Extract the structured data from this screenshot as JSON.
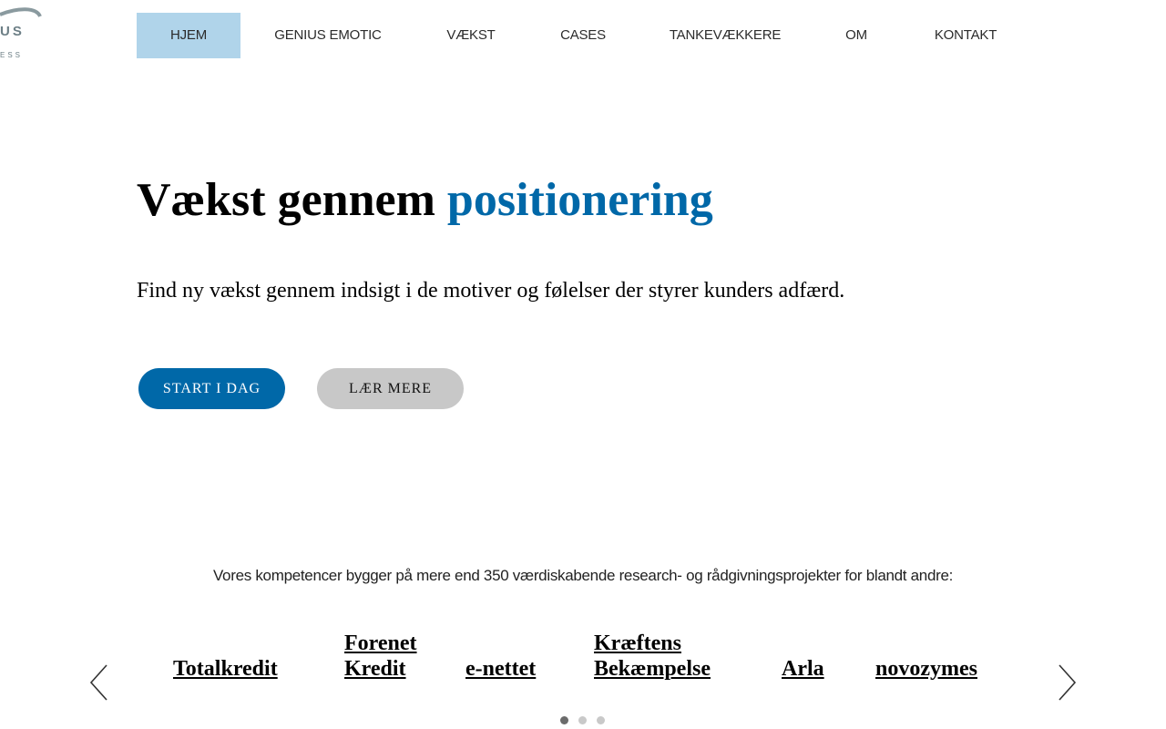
{
  "logo": {
    "word": "US",
    "sub": "ESS"
  },
  "nav": {
    "items": [
      {
        "label": "HJEM",
        "active": true
      },
      {
        "label": "GENIUS EMOTIC",
        "active": false
      },
      {
        "label": "VÆKST",
        "active": false
      },
      {
        "label": "CASES",
        "active": false
      },
      {
        "label": "TANKEVÆKKERE",
        "active": false
      },
      {
        "label": "OM",
        "active": false
      },
      {
        "label": "KONTAKT",
        "active": false
      }
    ]
  },
  "hero": {
    "title_plain": "Vækst gennem",
    "title_accent": "positionering",
    "subtitle": "Find ny vækst gennem indsigt i de motiver og følelser der styrer kunders adfærd.",
    "primary_button": "START I DAG",
    "secondary_button": "LÆR MERE"
  },
  "competence": {
    "text": "Vores kompetencer bygger på mere end 350 værdiskabende research- og rådgivningsprojekter for blandt andre:"
  },
  "clients": [
    {
      "line1": "",
      "line2": "Totalkredit"
    },
    {
      "line1": "Forenet",
      "line2": "Kredit"
    },
    {
      "line1": "",
      "line2": "e-nettet"
    },
    {
      "line1": "Kræftens",
      "line2": "Bekæmpelse"
    },
    {
      "line1": "",
      "line2": "Arla"
    },
    {
      "line1": "",
      "line2": "novozymes"
    }
  ],
  "carousel": {
    "active_dot": 1,
    "dot_count": 3
  },
  "colors": {
    "accent": "#0068a8",
    "nav_active_bg": "#b0d4ea",
    "secondary_button_bg": "#c8c8c8",
    "logo_grey": "#6d7f86"
  },
  "icons": {
    "prev": "chevron-left-icon",
    "next": "chevron-right-icon"
  }
}
